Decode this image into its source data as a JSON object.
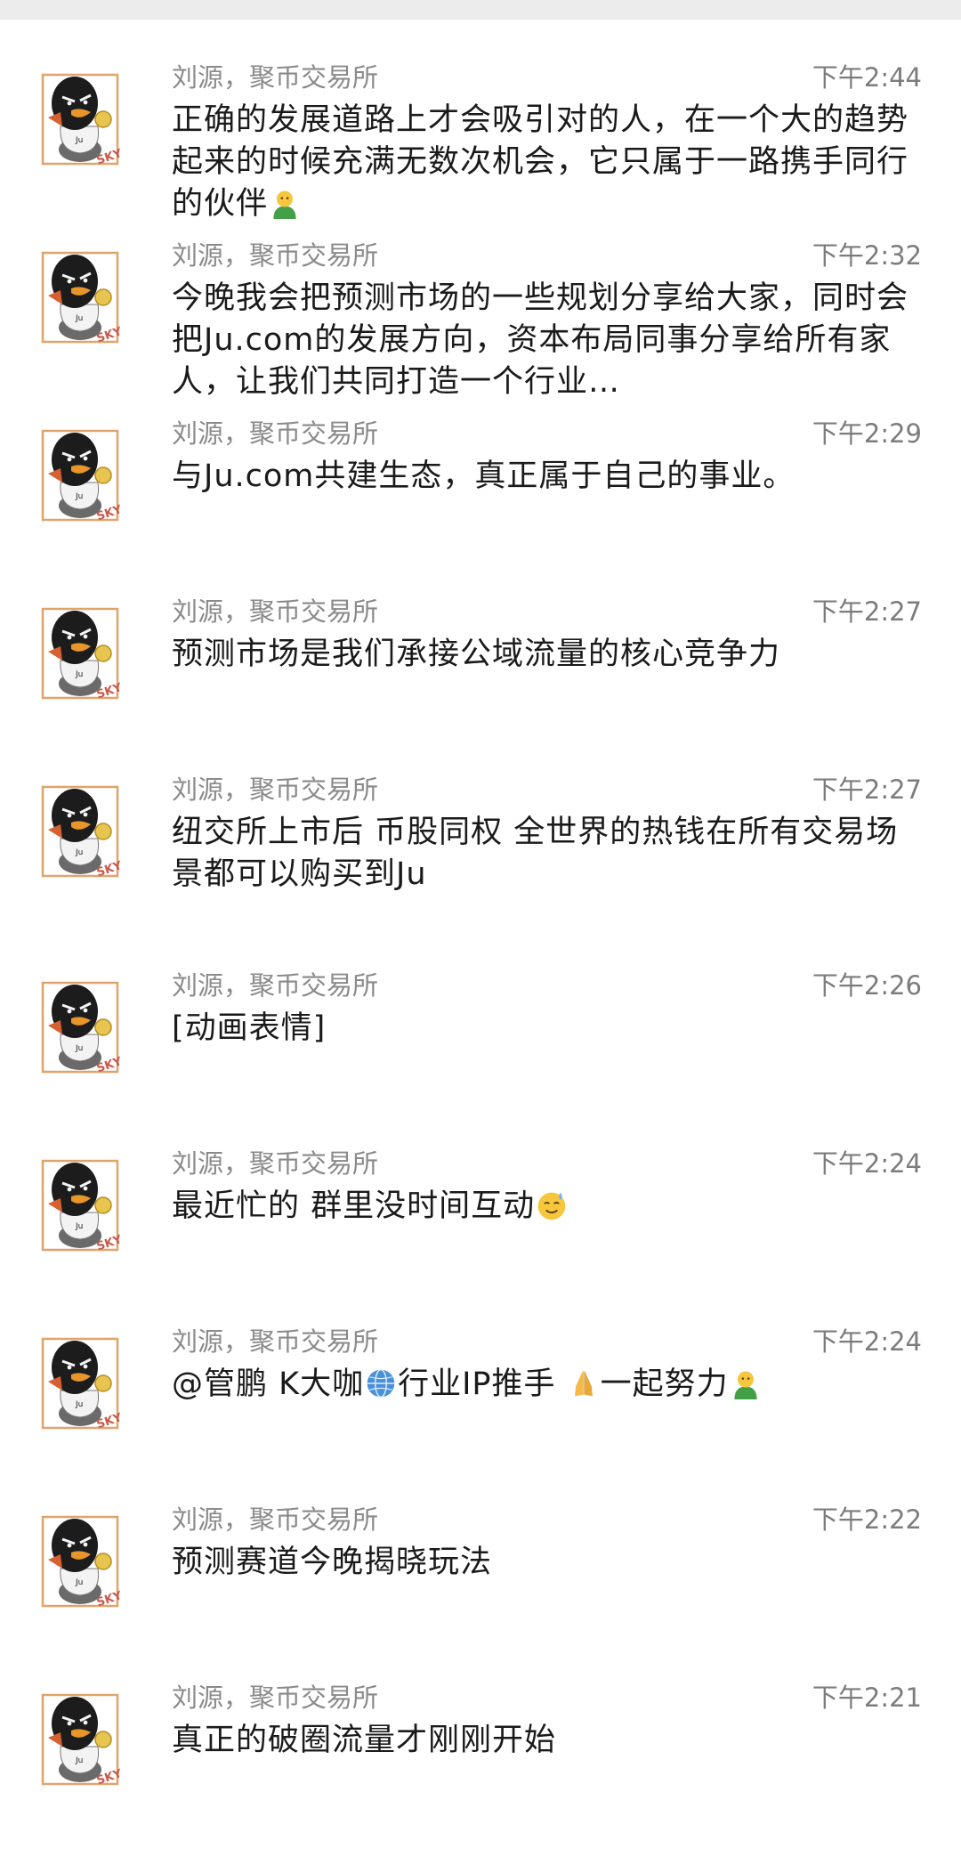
{
  "messages": [
    {
      "sender": "刘源，聚币交易所",
      "time": "下午2:44",
      "parts": [
        {
          "t": "text",
          "v": "正确的发展道路上才会吸引对的人，在一个大的趋势起来的时候充满无数次机会，它只属于一路携手同行的伙伴"
        },
        {
          "t": "emoji",
          "v": "person-emoji"
        }
      ]
    },
    {
      "sender": "刘源，聚币交易所",
      "time": "下午2:32",
      "clamp": true,
      "parts": [
        {
          "t": "text",
          "v": "今晚我会把预测市场的一些规划分享给大家，同时会把Ju.com的发展方向，资本布局同事分享给所有家人，让我们共同打造一个行业…"
        }
      ]
    },
    {
      "sender": "刘源，聚币交易所",
      "time": "下午2:29",
      "parts": [
        {
          "t": "text",
          "v": "与Ju.com共建生态，真正属于自己的事业。"
        }
      ]
    },
    {
      "sender": "刘源，聚币交易所",
      "time": "下午2:27",
      "parts": [
        {
          "t": "text",
          "v": "预测市场是我们承接公域流量的核心竞争力"
        }
      ]
    },
    {
      "sender": "刘源，聚币交易所",
      "time": "下午2:27",
      "parts": [
        {
          "t": "text",
          "v": "纽交所上市后 币股同权 全世界的热钱在所有交易场景都可以购买到Ju"
        }
      ]
    },
    {
      "sender": "刘源，聚币交易所",
      "time": "下午2:26",
      "parts": [
        {
          "t": "text",
          "v": "[动画表情]"
        }
      ]
    },
    {
      "sender": "刘源，聚币交易所",
      "time": "下午2:24",
      "parts": [
        {
          "t": "text",
          "v": "最近忙的 群里没时间互动"
        },
        {
          "t": "emoji",
          "v": "sweat-smile-emoji"
        }
      ]
    },
    {
      "sender": "刘源，聚币交易所",
      "time": "下午2:24",
      "parts": [
        {
          "t": "text",
          "v": "@管鹏 K大咖"
        },
        {
          "t": "emoji",
          "v": "globe-emoji"
        },
        {
          "t": "text",
          "v": "行业IP推手 "
        },
        {
          "t": "emoji",
          "v": "pray-emoji"
        },
        {
          "t": "text",
          "v": "一起努力"
        },
        {
          "t": "emoji",
          "v": "person-emoji"
        }
      ]
    },
    {
      "sender": "刘源，聚币交易所",
      "time": "下午2:22",
      "parts": [
        {
          "t": "text",
          "v": "预测赛道今晚揭晓玩法"
        }
      ]
    },
    {
      "sender": "刘源，聚币交易所",
      "time": "下午2:21",
      "parts": [
        {
          "t": "text",
          "v": "真正的破圈流量才刚刚开始"
        }
      ]
    }
  ],
  "avatar": {
    "icon": "penguin-avatar-icon",
    "badge_text": "SKY",
    "colors": {
      "frame": "#e0a46a",
      "body": "#1c1c1c",
      "beak": "#e8962a",
      "shirt": "#f3f3f3",
      "coin": "#e8c450"
    }
  }
}
